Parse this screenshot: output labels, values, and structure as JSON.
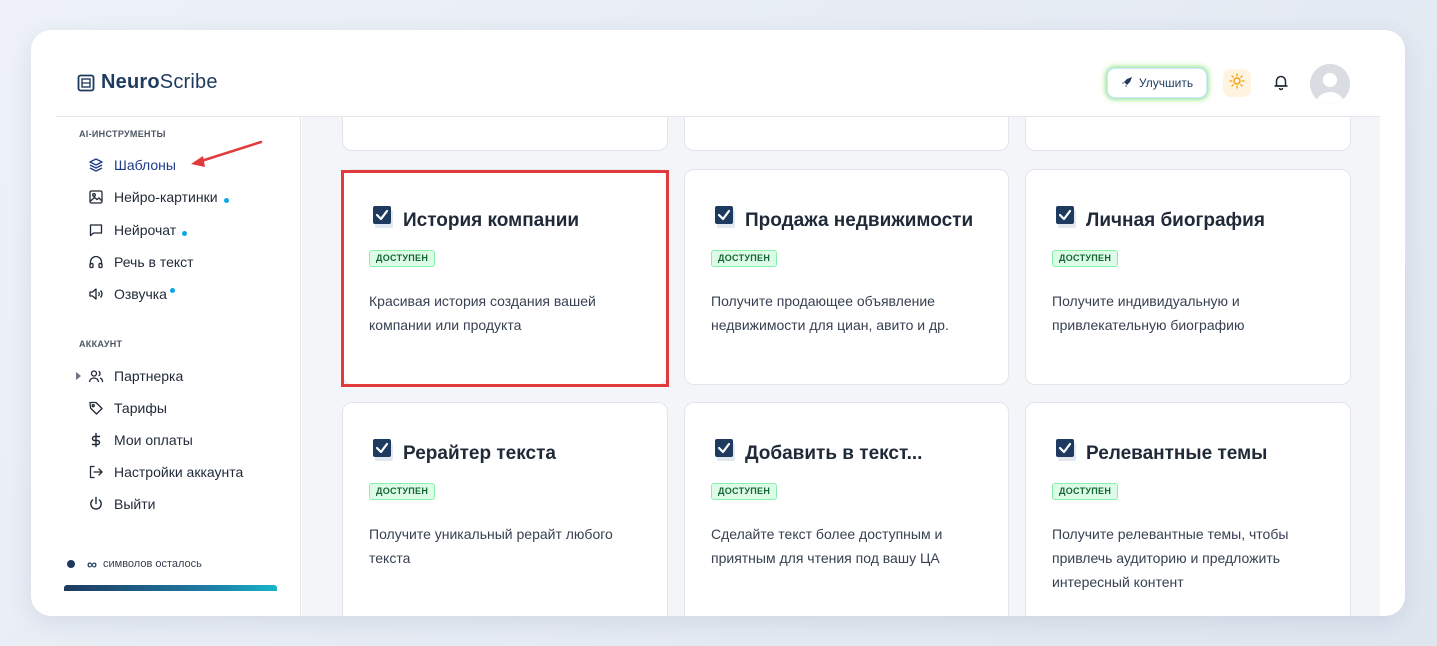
{
  "header": {
    "logo_bold": "Neuro",
    "logo_light": "Scribe",
    "upgrade_label": "Улучшить"
  },
  "sidebar": {
    "section_tools": "AI-ИНСТРУМЕНТЫ",
    "tools": [
      {
        "label": "Шаблоны",
        "icon": "layers-icon",
        "active": true
      },
      {
        "label": "Нейро-картинки",
        "icon": "image-icon",
        "dot": true
      },
      {
        "label": "Нейрочат",
        "icon": "chat-icon",
        "dot": true
      },
      {
        "label": "Речь в текст",
        "icon": "headphones-icon"
      },
      {
        "label": "Озвучка",
        "icon": "speaker-icon",
        "dot": true
      }
    ],
    "section_account": "АККАУНТ",
    "account": [
      {
        "label": "Партнерка",
        "icon": "users-icon"
      },
      {
        "label": "Тарифы",
        "icon": "tag-icon"
      },
      {
        "label": "Мои оплаты",
        "icon": "dollar-icon"
      },
      {
        "label": "Настройки аккаунта",
        "icon": "settings-exit-icon"
      },
      {
        "label": "Выйти",
        "icon": "power-icon"
      }
    ],
    "symbols_infinity": "∞",
    "symbols_label": "символов осталось"
  },
  "cards": [
    {
      "title": "История компании",
      "badge": "ДОСТУПЕН",
      "desc": "Красивая история создания вашей компании или продукта"
    },
    {
      "title": "Продажа недвижимости",
      "badge": "ДОСТУПЕН",
      "desc": "Получите продающее объявление недвижимости для циан, авито и др."
    },
    {
      "title": "Личная биография",
      "badge": "ДОСТУПЕН",
      "desc": "Получите индивидуальную и привлекательную биографию"
    },
    {
      "title": "Рерайтер текста",
      "badge": "ДОСТУПЕН",
      "desc": "Получите уникальный рерайт любого текста"
    },
    {
      "title": "Добавить в текст...",
      "badge": "ДОСТУПЕН",
      "desc": "Сделайте текст более доступным и приятным для чтения под вашу ЦА"
    },
    {
      "title": "Релевантные темы",
      "badge": "ДОСТУПЕН",
      "desc": "Получите релевантные темы, чтобы привлечь аудиторию и предложить интересный контент"
    }
  ],
  "colors": {
    "accent": "#1e3a5f",
    "highlight": "#e03a3a",
    "badge_bg": "#dcfce7",
    "dot": "#0ea5e9"
  }
}
